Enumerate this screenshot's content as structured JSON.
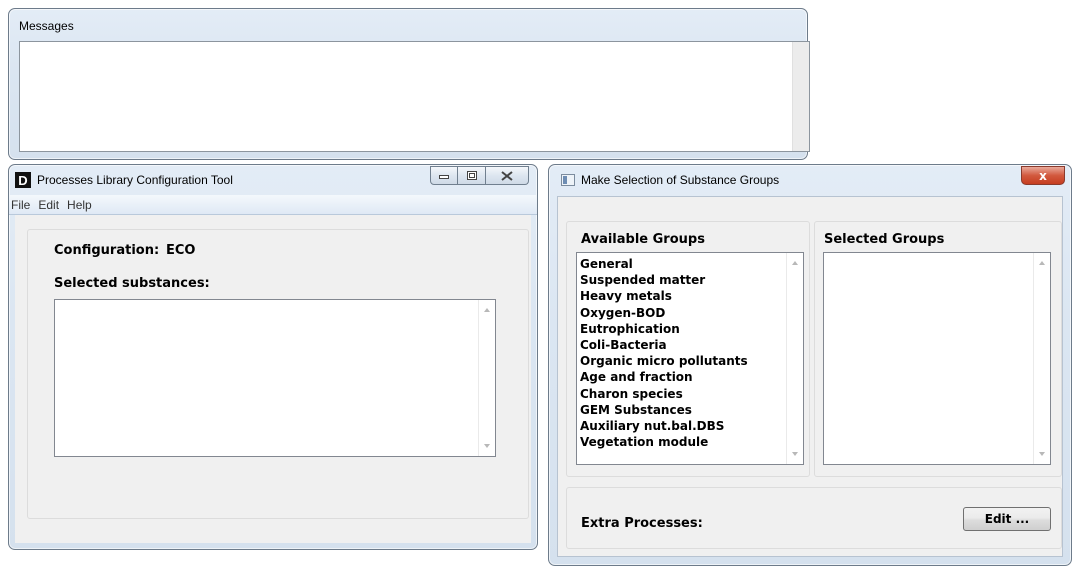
{
  "messages_window": {
    "title": "Messages"
  },
  "plct_window": {
    "title": "Processes Library Configuration Tool",
    "icon_letter": "D",
    "menu": [
      "File",
      "Edit",
      "Help"
    ],
    "configuration_label": "Configuration:",
    "configuration_value": "ECO",
    "selected_substances_label": "Selected substances:",
    "selected_substances": []
  },
  "selection_dialog": {
    "title": "Make Selection of Substance Groups",
    "close_glyph": "x",
    "available_groups_label": "Available Groups",
    "selected_groups_label": "Selected Groups",
    "available_groups": [
      "General",
      "Suspended matter",
      "Heavy metals",
      "Oxygen-BOD",
      "Eutrophication",
      "Coli-Bacteria",
      "Organic micro pollutants",
      "Age and fraction",
      "Charon species",
      "GEM Substances",
      "Auxiliary nut.bal.DBS",
      "Vegetation module"
    ],
    "selected_groups": [],
    "extra_processes_label": "Extra Processes:",
    "edit_button_label": "Edit ..."
  }
}
